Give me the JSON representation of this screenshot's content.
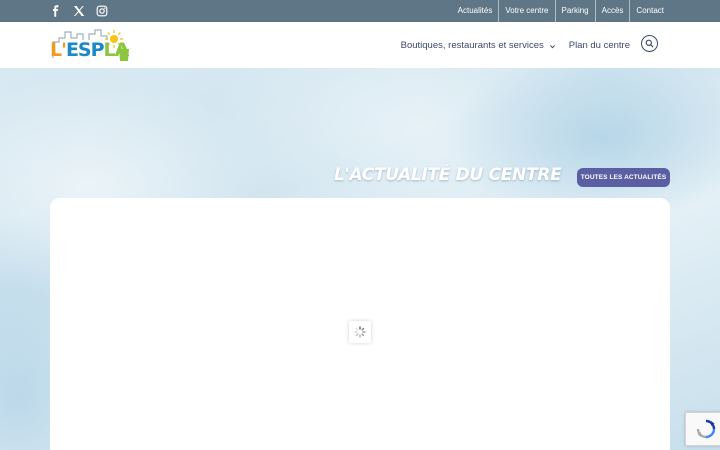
{
  "topbar": {
    "social": [
      {
        "icon": "facebook-icon"
      },
      {
        "icon": "x-twitter-icon"
      },
      {
        "icon": "instagram-icon"
      }
    ],
    "links": [
      "Actualités",
      "Votre centre",
      "Parking",
      "Accès",
      "Contact"
    ]
  },
  "header": {
    "logo_text": "L'ESPLA",
    "nav": {
      "shops": "Boutiques, restaurants et services",
      "map": "Plan du centre"
    }
  },
  "hero": {
    "title": "L'ACTUALITÉ DU CENTRE",
    "button": "TOUTES LES ACTUALITÉS"
  },
  "colors": {
    "topbar": "#5e7685",
    "nav_text": "#3c4a69",
    "accent_button": "#5a5fa3",
    "logo_orange": "#f29a1f",
    "logo_green": "#8cc63f",
    "logo_blue": "#1e88c7"
  }
}
